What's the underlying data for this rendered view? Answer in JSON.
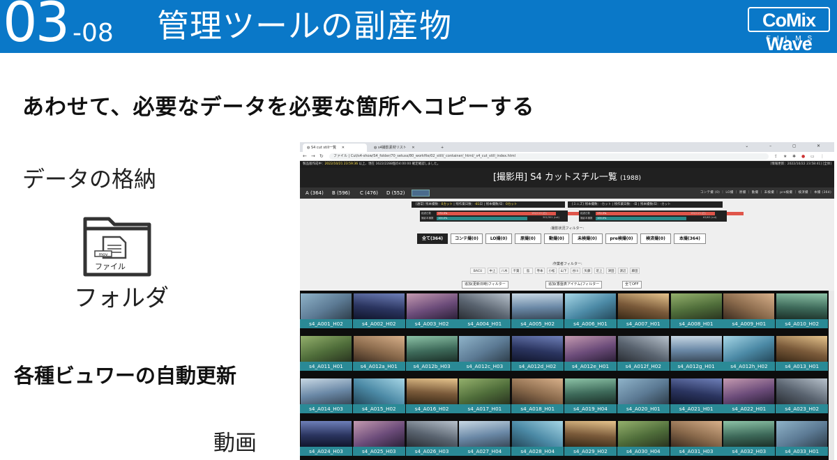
{
  "slide": {
    "section_number": "03",
    "section_sub": "-08",
    "title": "管理ツールの副産物",
    "logo_main": "CoMix Wave",
    "logo_sub": "FILMS",
    "subtitle": "あわせて、必要なデータを必要な箇所へコピーする",
    "label_data_storage": "データの格納",
    "folder_icon_badge": "mov",
    "folder_icon_text": "ファイル",
    "label_folder": "フォルダ",
    "label_viewer": "各種ビュワーの自動更新",
    "label_movie": "動画"
  },
  "colors": {
    "header_blue": "#0a78c8",
    "label_teal": "#2a8a96",
    "progress_red": "#e0554a",
    "progress_teal": "#2a8a8a"
  },
  "browser": {
    "tabs": [
      {
        "label": "S4 cut still一覧",
        "icon": "globe-icon"
      },
      {
        "label": "s4撮影素材リスト",
        "icon": "globe-icon"
      }
    ],
    "window_controls": "⌄ – ◻ ✕",
    "url": "ファイル | Cut/s4-show/S4_folder/70_setuss/80_workfile/02_still/_container/_html/_s4_cut_still_index.html",
    "status_left_label": "製品版作成中：",
    "status_left_date": "2022/10/21 23:59:36",
    "status_left_rest": "以上、現在 1622/2288個の4:00:00 確定確認しました。",
    "status_right": "[情報更新：2022/10/22 23:58:41]",
    "status_right_btn": "[全体]",
    "page_title": "[撮影用] S4 カットスチル一覧",
    "page_count": "(1988)",
    "groups": [
      "A (364)",
      "B (596)",
      "C (476)",
      "D (552)"
    ],
    "right_links": "コンテ撮 (0) ｜ LO撮 ｜ 原撮 ｜ 動撮 ｜ 未検撮 ｜ pre検撮 ｜ 検済撮 ｜ 本撮 (364)",
    "stat_left": {
      "pre": "[通常] 残本撮数：",
      "a": "0カット",
      "mid": " | 残作業日数：",
      "b": "-81",
      "mid2": "日 | 残本撮数/日：",
      "c": "0カット"
    },
    "stat_right": "[ミニズ] 残本撮数：-カット | 残作業日数：-日 | 残本撮数/日：-カット",
    "prog_left": {
      "l1": "経過日数",
      "v1": "172.3%",
      "c1": "192/113 (日)",
      "l2": "撮影本撮数",
      "v2": "100.0%",
      "c2": "301/301 (cut)",
      "r1": 0.92,
      "r2": 0.7
    },
    "prog_right": {
      "l1": "経過日数",
      "v1": "172.3%",
      "c1": "192/113 (日)",
      "l2": "撮影本撮数",
      "v2": "100.0%",
      "c2": "63/63 (cut)",
      "r1": 0.92,
      "r2": 0.7
    },
    "status_filter_label": ":撮影状況フィルター:",
    "status_filters": [
      {
        "label": "全て(364)",
        "selected": true
      },
      {
        "label": "コンテ撮(0)",
        "selected": false
      },
      {
        "label": "LO撮(0)",
        "selected": false
      },
      {
        "label": "原撮(0)",
        "selected": false
      },
      {
        "label": "動撮(0)",
        "selected": false
      },
      {
        "label": "未検撮(0)",
        "selected": false
      },
      {
        "label": "pre検撮(0)",
        "selected": false
      },
      {
        "label": "検済撮(0)",
        "selected": false
      },
      {
        "label": "本撮(364)",
        "selected": false
      }
    ],
    "author_filter_label": ":作業者フィルター:",
    "author_filters": [
      "BACU",
      "中上",
      "八木",
      "千葉",
      "島",
      "寺本",
      "小松",
      "山下",
      "谷川",
      "矢藤",
      "近上",
      "津田",
      "渡辺",
      "藤田"
    ],
    "other_filters": [
      "追加(更新日時)フィルター",
      "追加(香盤表アイテム)フィルター",
      "全てOFF"
    ],
    "cuts": [
      "s4_A001_H02",
      "s4_A002_H02",
      "s4_A003_H02",
      "s4_A004_H01",
      "s4_A005_H02",
      "s4_A006_H01",
      "s4_A007_H01",
      "s4_A008_H01",
      "s4_A009_H01",
      "s4_A010_H02",
      "s4_A011_H01",
      "s4_A012a_H01",
      "s4_A012b_H03",
      "s4_A012c_H03",
      "s4_A012d_H02",
      "s4_A012e_H01",
      "s4_A012f_H02",
      "s4_A012g_H01",
      "s4_A012h_H02",
      "s4_A013_H01",
      "s4_A014_H03",
      "s4_A015_H02",
      "s4_A016_H02",
      "s4_A017_H01",
      "s4_A018_H01",
      "s4_A019_H04",
      "s4_A020_H01",
      "s4_A021_H01",
      "s4_A022_H01",
      "s4_A023_H02",
      "s4_A024_H03",
      "s4_A025_H03",
      "s4_A026_H03",
      "s4_A027_H04",
      "s4_A028_H04",
      "s4_A029_H02",
      "s4_A030_H04",
      "s4_A031_H03",
      "s4_A032_H03",
      "s4_A033_H01"
    ]
  }
}
